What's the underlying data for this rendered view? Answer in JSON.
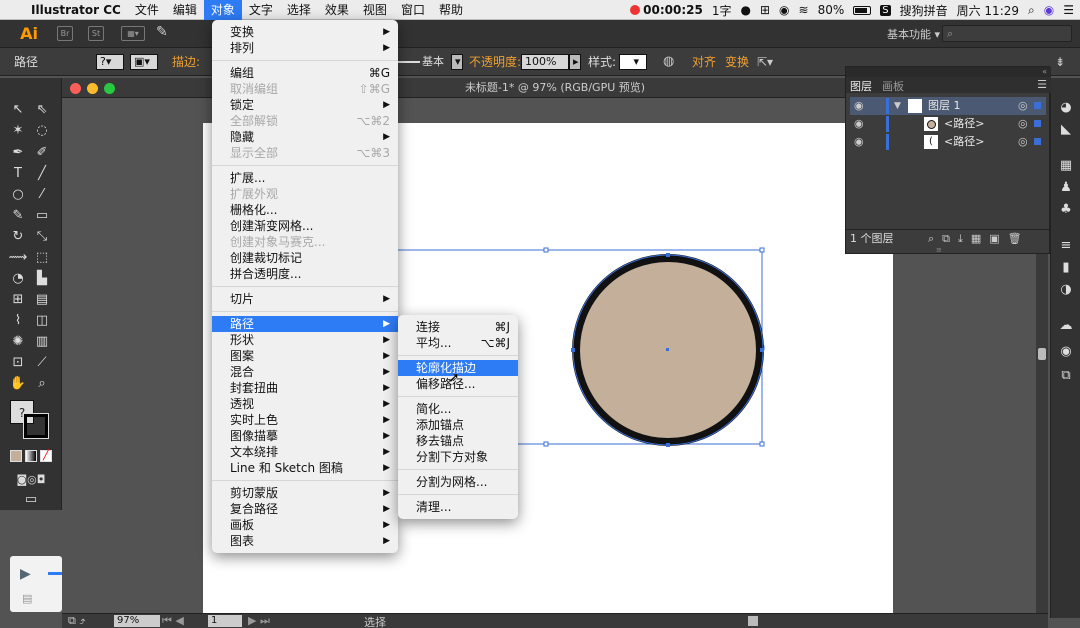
{
  "menubar": {
    "apple": "",
    "app": "Illustrator CC",
    "items": [
      "文件",
      "编辑",
      "对象",
      "文字",
      "选择",
      "效果",
      "视图",
      "窗口",
      "帮助"
    ],
    "active": "对象",
    "status": {
      "timer": "00:00:25",
      "ime_char": "1字",
      "battery": "80%",
      "ime_name": "搜狗拼音",
      "clock": "周六 11:29"
    }
  },
  "appbar": {
    "logo": "Ai",
    "br": "Br",
    "st": "St",
    "workspace": "基本功能 ▾"
  },
  "control_bar": {
    "path_label": "路径",
    "stroke_label": "描边:",
    "brush_label": "基本",
    "opacity_label": "不透明度:",
    "opacity_value": "100%",
    "style_label": "样式:",
    "align_label": "对齐",
    "transform_label": "变换"
  },
  "document": {
    "title": "未标题-1* @ 97% (RGB/GPU 预览)",
    "zoom": "97%",
    "artboard_num": "1",
    "status_tool": "选择"
  },
  "object_menu": [
    {
      "label": "变换",
      "sub": true
    },
    {
      "label": "排列",
      "sub": true
    },
    {
      "sep": true
    },
    {
      "label": "编组",
      "shortcut": "⌘G"
    },
    {
      "label": "取消编组",
      "shortcut": "⇧⌘G",
      "disabled": true
    },
    {
      "label": "锁定",
      "sub": true
    },
    {
      "label": "全部解锁",
      "shortcut": "⌥⌘2",
      "disabled": true
    },
    {
      "label": "隐藏",
      "sub": true
    },
    {
      "label": "显示全部",
      "shortcut": "⌥⌘3",
      "disabled": true
    },
    {
      "sep": true
    },
    {
      "label": "扩展..."
    },
    {
      "label": "扩展外观",
      "disabled": true
    },
    {
      "label": "栅格化..."
    },
    {
      "label": "创建渐变网格..."
    },
    {
      "label": "创建对象马赛克...",
      "disabled": true
    },
    {
      "label": "创建裁切标记"
    },
    {
      "label": "拼合透明度..."
    },
    {
      "sep": true
    },
    {
      "label": "切片",
      "sub": true
    },
    {
      "sep": true
    },
    {
      "label": "路径",
      "sub": true,
      "highlight": true
    },
    {
      "label": "形状",
      "sub": true
    },
    {
      "label": "图案",
      "sub": true
    },
    {
      "label": "混合",
      "sub": true
    },
    {
      "label": "封套扭曲",
      "sub": true
    },
    {
      "label": "透视",
      "sub": true
    },
    {
      "label": "实时上色",
      "sub": true
    },
    {
      "label": "图像描摹",
      "sub": true
    },
    {
      "label": "文本绕排",
      "sub": true
    },
    {
      "label": "Line 和 Sketch 图稿",
      "sub": true
    },
    {
      "sep": true
    },
    {
      "label": "剪切蒙版",
      "sub": true
    },
    {
      "label": "复合路径",
      "sub": true
    },
    {
      "label": "画板",
      "sub": true
    },
    {
      "label": "图表",
      "sub": true
    }
  ],
  "path_submenu": [
    {
      "label": "连接",
      "shortcut": "⌘J"
    },
    {
      "label": "平均...",
      "shortcut": "⌥⌘J"
    },
    {
      "sep": true
    },
    {
      "label": "轮廓化描边",
      "highlight": true
    },
    {
      "label": "偏移路径..."
    },
    {
      "sep": true
    },
    {
      "label": "简化..."
    },
    {
      "label": "添加锚点"
    },
    {
      "label": "移去锚点"
    },
    {
      "label": "分割下方对象"
    },
    {
      "sep": true
    },
    {
      "label": "分割为网格..."
    },
    {
      "sep": true
    },
    {
      "label": "清理..."
    }
  ],
  "layers_panel": {
    "tab_layers": "图层",
    "tab_artboards": "画板",
    "layer_name": "图层 1",
    "path1": "<路径>",
    "path2": "<路径>",
    "footer": "1 个图层"
  },
  "colors": {
    "accent": "#2e7bf6",
    "circle_fill": "#c4b09a",
    "circle_stroke": "#111111",
    "selection": "#3b6fd8"
  }
}
